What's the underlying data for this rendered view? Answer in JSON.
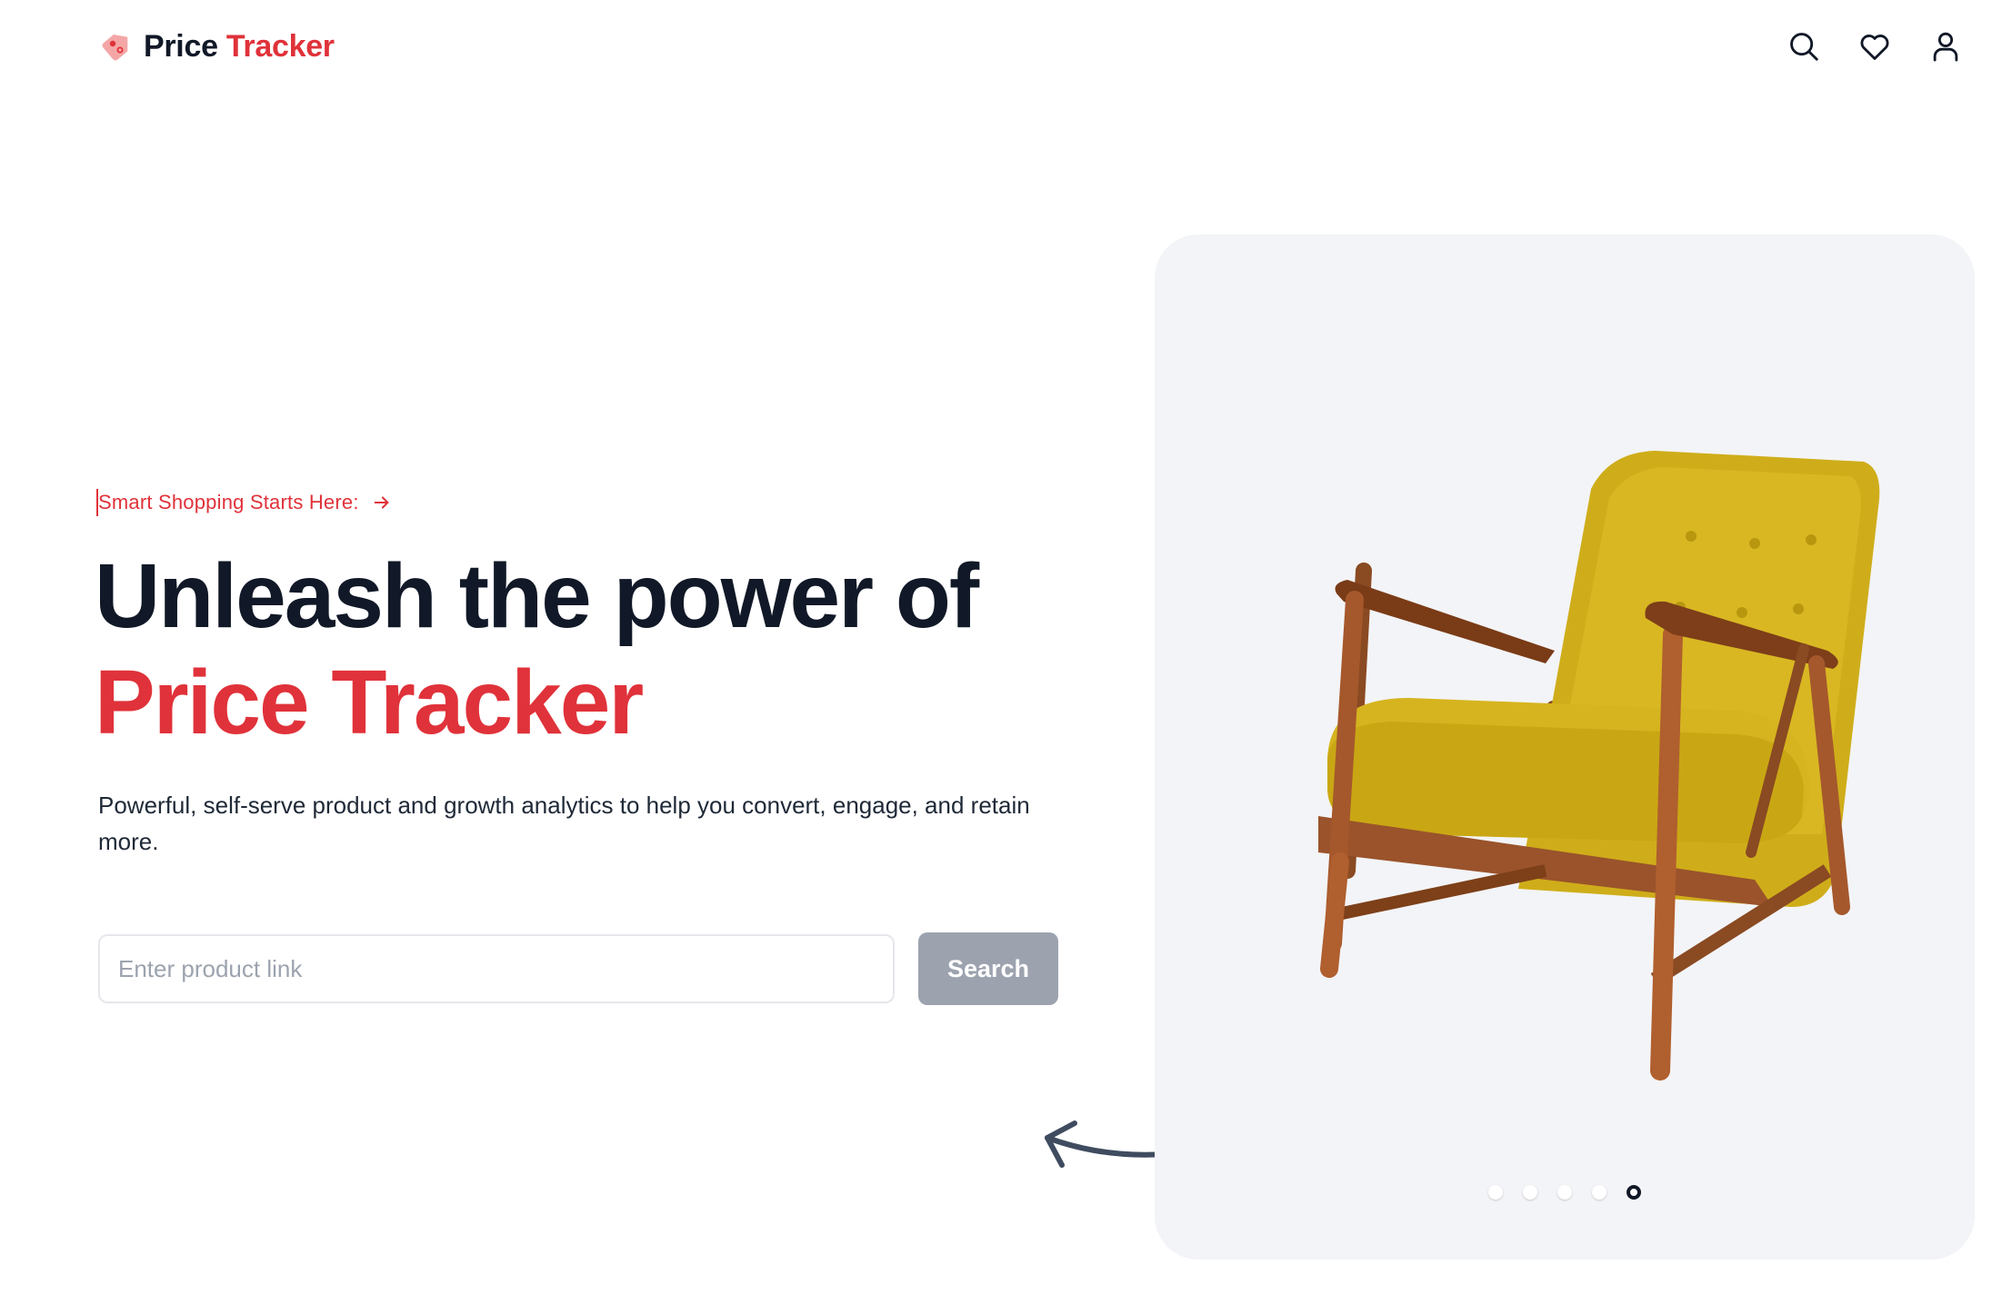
{
  "brand": {
    "name_part1": "Price",
    "name_part2": "Tracker",
    "accent_color": "#e0323a",
    "icon": "price-tag-icon"
  },
  "nav": {
    "icons": [
      "search-icon",
      "heart-icon",
      "user-icon"
    ]
  },
  "hero": {
    "eyebrow": "Smart Shopping Starts Here:",
    "eyebrow_icon": "arrow-right-icon",
    "headline_line1": "Unleash the power of",
    "headline_line2": "Price Tracker",
    "subtext": "Powerful, self-serve product and growth analytics to help you convert, engage, and retain more.",
    "search": {
      "placeholder": "Enter product link",
      "value": "",
      "button_label": "Search"
    }
  },
  "carousel": {
    "image": "yellow-armchair",
    "slide_count": 5,
    "active_index": 5
  },
  "colors": {
    "heading": "#111827",
    "card_background": "#f3f4f7",
    "button_disabled": "#9ca3af"
  }
}
